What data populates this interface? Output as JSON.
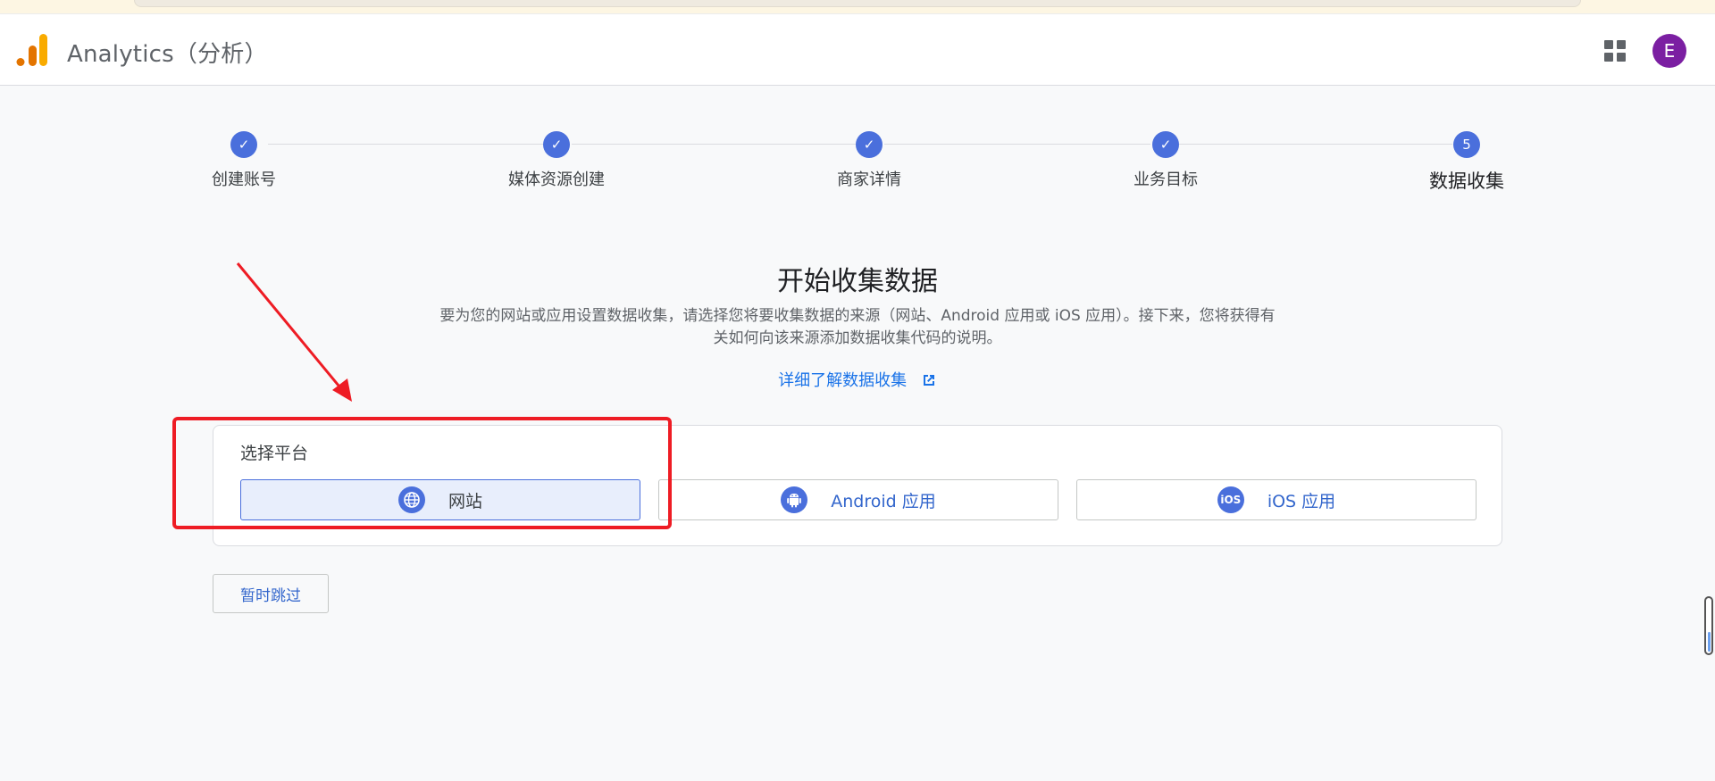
{
  "header": {
    "app_title": "Analytics（分析）",
    "avatar_letter": "E",
    "logo_icon": "analytics-logo-icon",
    "apps_icon": "apps-grid-icon"
  },
  "stepper": {
    "steps": [
      {
        "label": "创建账号",
        "state": "done"
      },
      {
        "label": "媒体资源创建",
        "state": "done"
      },
      {
        "label": "商家详情",
        "state": "done"
      },
      {
        "label": "业务目标",
        "state": "done"
      },
      {
        "label": "数据收集",
        "state": "current",
        "number": "5"
      }
    ]
  },
  "main": {
    "title": "开始收集数据",
    "description_line1": "要为您的网站或应用设置数据收集，请选择您将要收集数据的来源（网站、Android 应用或 iOS 应用）。接下来，您将获得有",
    "description_line2": "关如何向该来源添加数据收集代码的说明。",
    "learn_more": "详细了解数据收集"
  },
  "platform": {
    "label": "选择平台",
    "options": [
      {
        "label": "网站",
        "icon": "globe-icon",
        "selected": true
      },
      {
        "label": "Android 应用",
        "icon": "android-icon",
        "selected": false
      },
      {
        "label": "iOS 应用",
        "icon": "ios-icon",
        "selected": false,
        "icon_text": "iOS"
      }
    ]
  },
  "skip": {
    "label": "暂时跳过"
  },
  "colors": {
    "accent": "#4a6fdc",
    "link": "#1a73e8",
    "annotation_red": "#ee1c24",
    "avatar": "#7b1fa2"
  }
}
